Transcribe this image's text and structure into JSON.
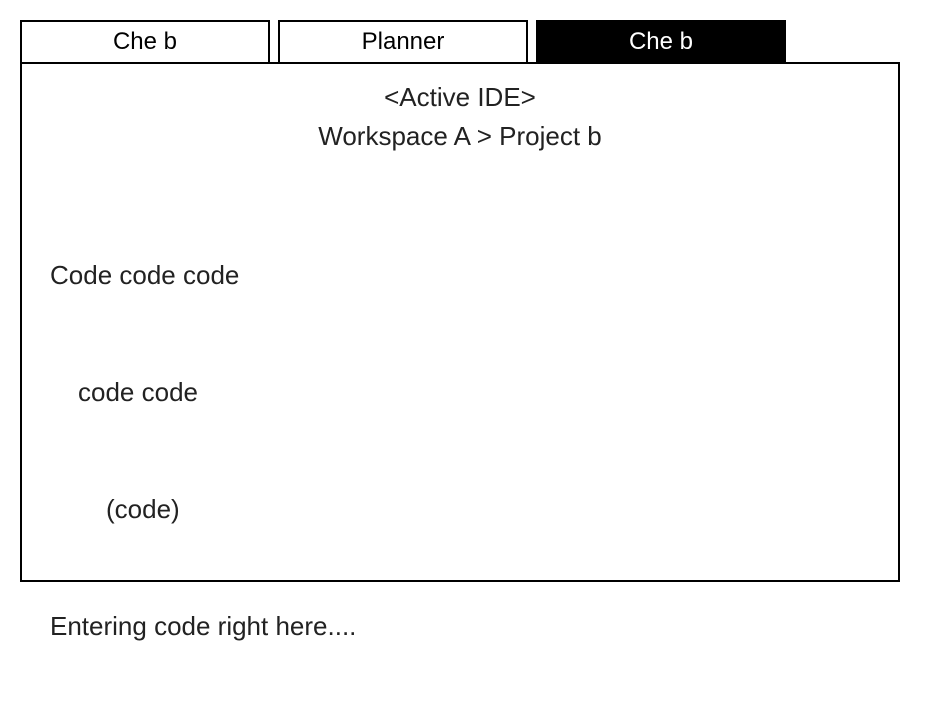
{
  "tabs": [
    {
      "label": "Che b",
      "active": false
    },
    {
      "label": "Planner",
      "active": false
    },
    {
      "label": "Che b",
      "active": true
    }
  ],
  "header": {
    "ide_title": "<Active IDE>",
    "breadcrumb": "Workspace A > Project b"
  },
  "code": {
    "line1": "Code code code",
    "line2": "code code",
    "line3": "(code)",
    "line4": "Entering code right here...."
  }
}
